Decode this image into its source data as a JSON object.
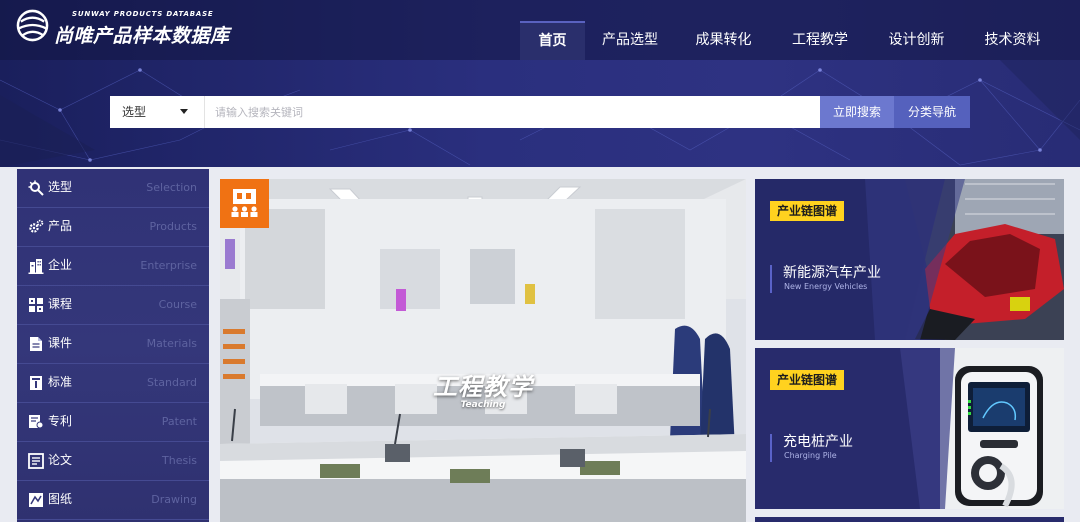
{
  "logo": {
    "subtitle": "SUNWAY PRODUCTS DATABASE",
    "title": "尚唯产品样本数据库",
    "icon": "globe-icon"
  },
  "nav": {
    "items": [
      {
        "label": "首页",
        "active": true
      },
      {
        "label": "产品选型",
        "active": false
      },
      {
        "label": "成果转化",
        "active": false
      },
      {
        "label": "工程教学",
        "active": false
      },
      {
        "label": "设计创新",
        "active": false
      },
      {
        "label": "技术资料",
        "active": false
      }
    ]
  },
  "search": {
    "select_value": "选型",
    "placeholder": "请输入搜索关键词",
    "search_button": "立即搜索",
    "category_button": "分类导航"
  },
  "sidebar": {
    "items": [
      {
        "label": "选型",
        "en": "Selection",
        "icon": "gear-magnifier-icon"
      },
      {
        "label": "产品",
        "en": "Products",
        "icon": "gears-icon"
      },
      {
        "label": "企业",
        "en": "Enterprise",
        "icon": "building-icon"
      },
      {
        "label": "课程",
        "en": "Course",
        "icon": "grid-course-icon"
      },
      {
        "label": "课件",
        "en": "Materials",
        "icon": "document-icon"
      },
      {
        "label": "标准",
        "en": "Standard",
        "icon": "book-icon"
      },
      {
        "label": "专利",
        "en": "Patent",
        "icon": "certificate-icon"
      },
      {
        "label": "论文",
        "en": "Thesis",
        "icon": "paper-icon"
      },
      {
        "label": "图纸",
        "en": "Drawing",
        "icon": "drawing-icon"
      }
    ]
  },
  "banner": {
    "title": "工程教学",
    "subtitle": "Teaching",
    "icon": "classroom-icon"
  },
  "cards": [
    {
      "tag": "产业链图谱",
      "title": "新能源汽车产业",
      "subtitle": "New Energy Vehicles"
    },
    {
      "tag": "产业链图谱",
      "title": "充电桩产业",
      "subtitle": "Charging Pile"
    }
  ],
  "colors": {
    "header_bg": "#2a2f7e",
    "sidebar_bg": "#303276",
    "search_button": "#6c78cf",
    "category_button": "#5561bd",
    "tag_yellow": "#ffd21f",
    "badge_orange": "#f07213"
  }
}
